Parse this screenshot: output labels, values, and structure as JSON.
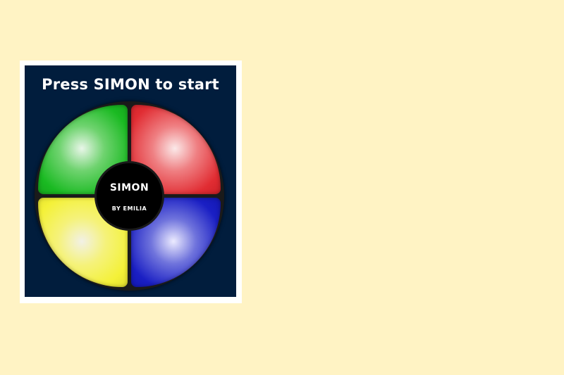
{
  "game": {
    "status_text": "Press SIMON to start",
    "center_title": "SIMON",
    "center_credit": "BY EMILIA"
  },
  "pads": [
    {
      "name": "green",
      "color": "#1aba22"
    },
    {
      "name": "red",
      "color": "#e12d33"
    },
    {
      "name": "yellow",
      "color": "#f4f138"
    },
    {
      "name": "blue",
      "color": "#1a1fc4"
    }
  ],
  "colors": {
    "page_background": "#fff3c4",
    "board_background": "#011d3d",
    "frame": "#ffffff",
    "center": "#000000"
  }
}
